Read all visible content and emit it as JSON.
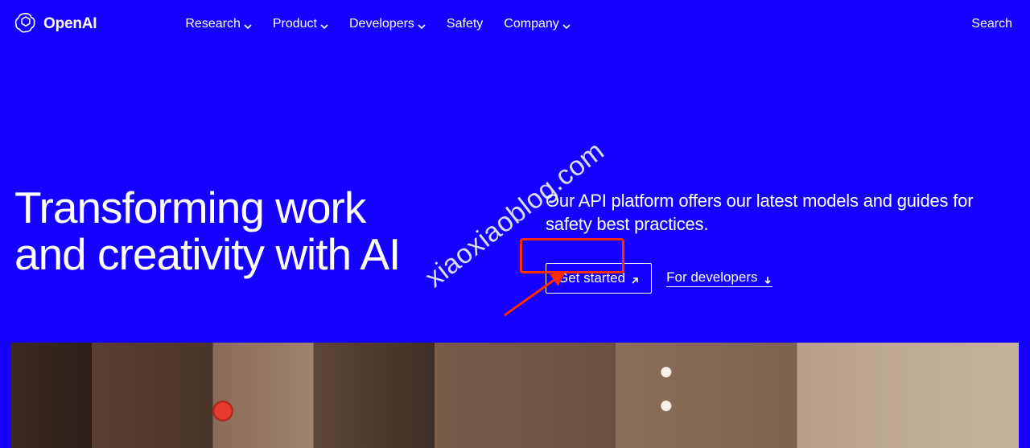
{
  "brand": {
    "name": "OpenAI"
  },
  "nav": {
    "items": [
      {
        "label": "Research",
        "has_menu": true
      },
      {
        "label": "Product",
        "has_menu": true
      },
      {
        "label": "Developers",
        "has_menu": true
      },
      {
        "label": "Safety",
        "has_menu": false
      },
      {
        "label": "Company",
        "has_menu": true
      }
    ]
  },
  "search": {
    "label": "Search"
  },
  "hero": {
    "title_line1": "Transforming work",
    "title_line2": "and creativity with AI",
    "description": "Our API platform offers our latest models and guides for safety best practices.",
    "cta_primary": "Get started",
    "cta_secondary": "For developers"
  },
  "watermark": {
    "text": "xiaoxiaoblog.com"
  },
  "annotation": {
    "highlight_target": "get-started-button",
    "color": "#ff2a00"
  }
}
